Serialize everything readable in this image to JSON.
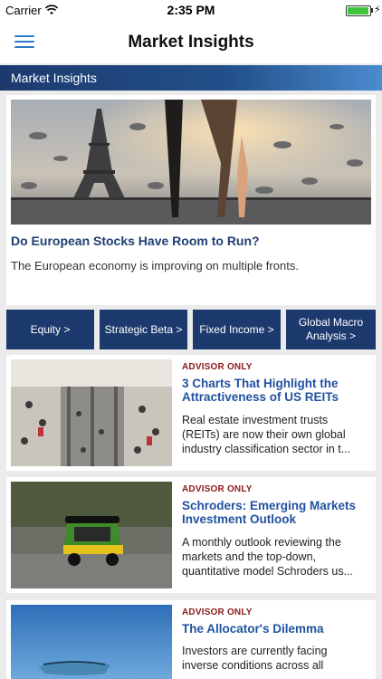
{
  "status_bar": {
    "carrier": "Carrier",
    "time": "2:35 PM"
  },
  "nav": {
    "title": "Market Insights",
    "menu_icon": "hamburger-menu-icon"
  },
  "section": {
    "title": "Market Insights"
  },
  "hero": {
    "title": "Do European Stocks Have Room to Run?",
    "description": "The European economy is improving on multiple fronts."
  },
  "categories": [
    {
      "label": "Equity >"
    },
    {
      "label": "Strategic Beta >"
    },
    {
      "label": "Fixed Income >"
    },
    {
      "label": "Global Macro Analysis >"
    }
  ],
  "articles": [
    {
      "tag": "ADVISOR ONLY",
      "title": "3 Charts That Highlight the Attractiveness of US REITs",
      "description": "Real estate investment trusts (REITs) are now their own global industry classification sector in t..."
    },
    {
      "tag": "ADVISOR ONLY",
      "title": "Schroders: Emerging Markets Investment Outlook",
      "description": "A monthly outlook reviewing the markets and the top-down, quantitative model Schroders us..."
    },
    {
      "tag": "ADVISOR ONLY",
      "title": "The Allocator's Dilemma",
      "description": "Investors are currently facing inverse conditions across all"
    }
  ],
  "colors": {
    "nav_blue": "#1d3a6e",
    "link_blue": "#2052a0",
    "tag_red": "#8b1a1a"
  }
}
